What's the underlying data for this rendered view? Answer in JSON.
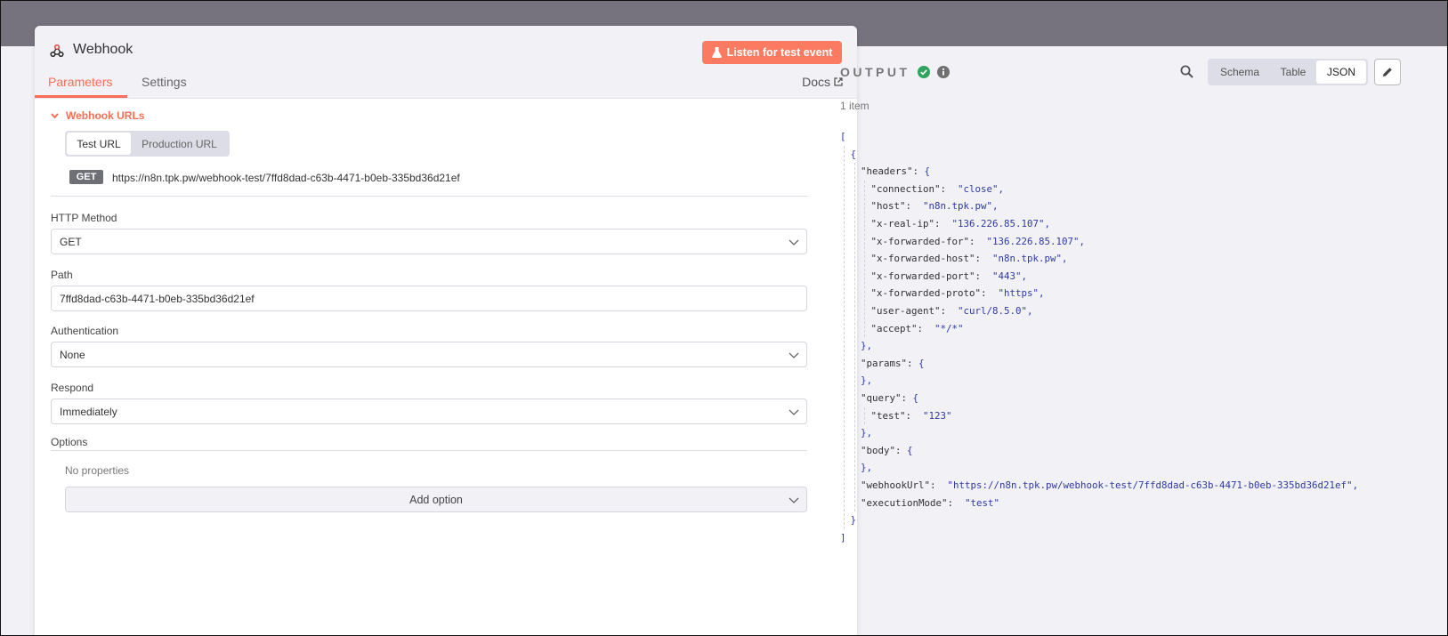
{
  "node": {
    "title": "Webhook",
    "listen_button": "Listen for test event",
    "tabs": [
      "Parameters",
      "Settings"
    ],
    "docs_label": "Docs",
    "section_title": "Webhook URLs",
    "url_tabs": [
      "Test URL",
      "Production URL"
    ],
    "method_badge": "GET",
    "webhook_url": "https://n8n.tpk.pw/webhook-test/7ffd8dad-c63b-4471-b0eb-335bd36d21ef",
    "fields": {
      "http_method": {
        "label": "HTTP Method",
        "value": "GET"
      },
      "path": {
        "label": "Path",
        "value": "7ffd8dad-c63b-4471-b0eb-335bd36d21ef"
      },
      "authentication": {
        "label": "Authentication",
        "value": "None"
      },
      "respond": {
        "label": "Respond",
        "value": "Immediately"
      }
    },
    "options_label": "Options",
    "no_properties": "No properties",
    "add_option": "Add option"
  },
  "output": {
    "title": "OUTPUT",
    "view_tabs": [
      "Schema",
      "Table",
      "JSON"
    ],
    "selected_view": "JSON",
    "item_count": "1 item",
    "json_lines": [
      {
        "indent": 0,
        "k": "",
        "v": "",
        "p": "["
      },
      {
        "indent": 1,
        "k": "",
        "v": "",
        "p": "{"
      },
      {
        "indent": 2,
        "k": "\"headers\"",
        "v": "",
        "p": ": {"
      },
      {
        "indent": 3,
        "k": "\"connection\"",
        "v": "\"close\"",
        "p": ","
      },
      {
        "indent": 3,
        "k": "\"host\"",
        "v": "\"n8n.tpk.pw\"",
        "p": ","
      },
      {
        "indent": 3,
        "k": "\"x-real-ip\"",
        "v": "\"136.226.85.107\"",
        "p": ","
      },
      {
        "indent": 3,
        "k": "\"x-forwarded-for\"",
        "v": "\"136.226.85.107\"",
        "p": ","
      },
      {
        "indent": 3,
        "k": "\"x-forwarded-host\"",
        "v": "\"n8n.tpk.pw\"",
        "p": ","
      },
      {
        "indent": 3,
        "k": "\"x-forwarded-port\"",
        "v": "\"443\"",
        "p": ","
      },
      {
        "indent": 3,
        "k": "\"x-forwarded-proto\"",
        "v": "\"https\"",
        "p": ","
      },
      {
        "indent": 3,
        "k": "\"user-agent\"",
        "v": "\"curl/8.5.0\"",
        "p": ","
      },
      {
        "indent": 3,
        "k": "\"accept\"",
        "v": "\"*/*\"",
        "p": ""
      },
      {
        "indent": 2,
        "k": "",
        "v": "",
        "p": "},"
      },
      {
        "indent": 2,
        "k": "\"params\"",
        "v": "",
        "p": ": {"
      },
      {
        "indent": 2,
        "k": "",
        "v": "",
        "p": "},"
      },
      {
        "indent": 2,
        "k": "\"query\"",
        "v": "",
        "p": ": {"
      },
      {
        "indent": 3,
        "k": "\"test\"",
        "v": "\"123\"",
        "p": ""
      },
      {
        "indent": 2,
        "k": "",
        "v": "",
        "p": "},"
      },
      {
        "indent": 2,
        "k": "\"body\"",
        "v": "",
        "p": ": {"
      },
      {
        "indent": 2,
        "k": "",
        "v": "",
        "p": "},"
      },
      {
        "indent": 2,
        "k": "\"webhookUrl\"",
        "v": "\"https://n8n.tpk.pw/webhook-test/7ffd8dad-c63b-4471-b0eb-335bd36d21ef\"",
        "p": ","
      },
      {
        "indent": 2,
        "k": "\"executionMode\"",
        "v": "\"test\"",
        "p": ""
      },
      {
        "indent": 1,
        "k": "",
        "v": "",
        "p": "}"
      },
      {
        "indent": 0,
        "k": "",
        "v": "",
        "p": "]"
      }
    ]
  },
  "colors": {
    "accent": "#fa6e55",
    "header_bar": "#76737f",
    "json_string": "#2f3aa3"
  }
}
